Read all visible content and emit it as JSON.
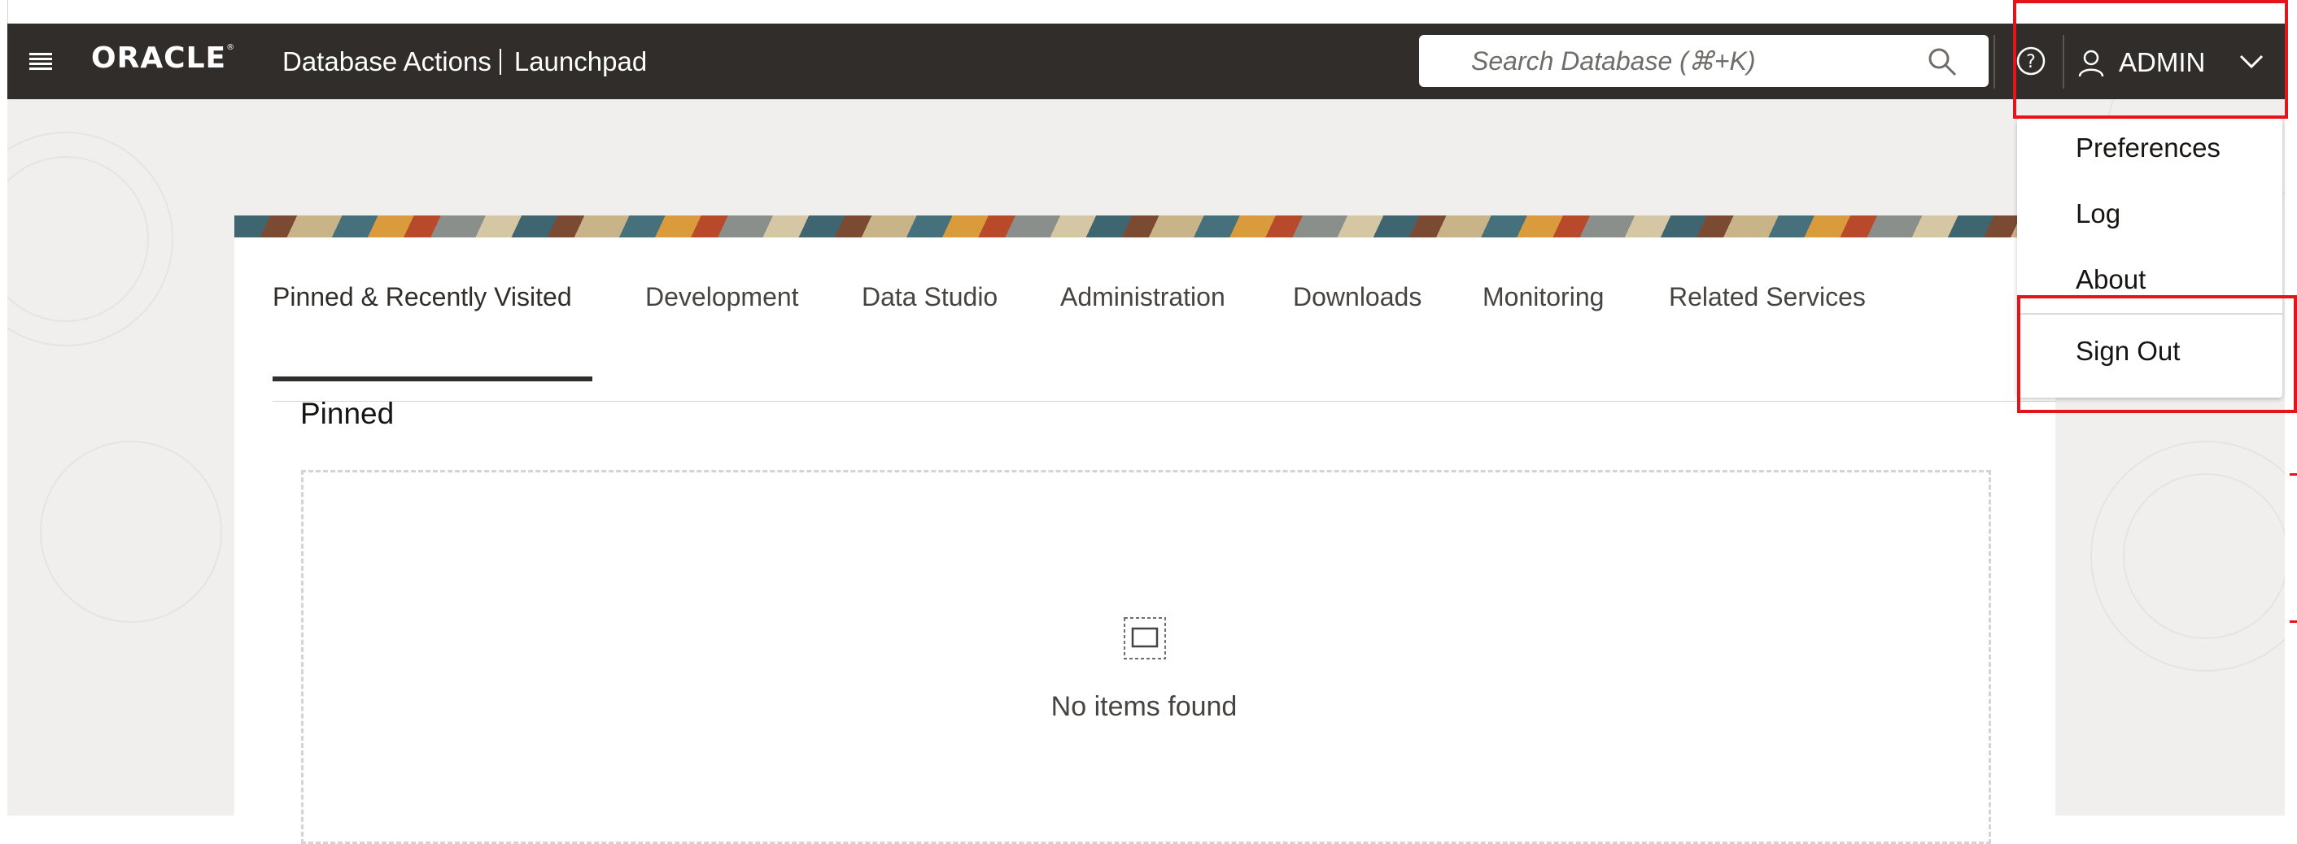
{
  "header": {
    "logo_text": "ORACLE",
    "logo_mark": "®",
    "app_name": "Database Actions",
    "page_name": "Launchpad",
    "search_placeholder": "Search Database (⌘+K)",
    "user_name": "ADMIN",
    "icons": [
      "hamburger-icon",
      "search-icon",
      "help-icon",
      "user-icon",
      "chevron-down-icon"
    ]
  },
  "tabs": [
    {
      "label": "Pinned & Recently Visited",
      "active": true
    },
    {
      "label": "Development"
    },
    {
      "label": "Data Studio"
    },
    {
      "label": "Administration"
    },
    {
      "label": "Downloads"
    },
    {
      "label": "Monitoring"
    },
    {
      "label": "Related Services"
    }
  ],
  "pinned": {
    "title": "Pinned",
    "empty_message": "No items found"
  },
  "user_dropdown": {
    "items": [
      "Preferences",
      "Log",
      "About",
      "Sign Out"
    ]
  },
  "colors": {
    "header_bg": "#312d2a",
    "page_bg": "#f0efed",
    "highlight": "#e5141b"
  }
}
